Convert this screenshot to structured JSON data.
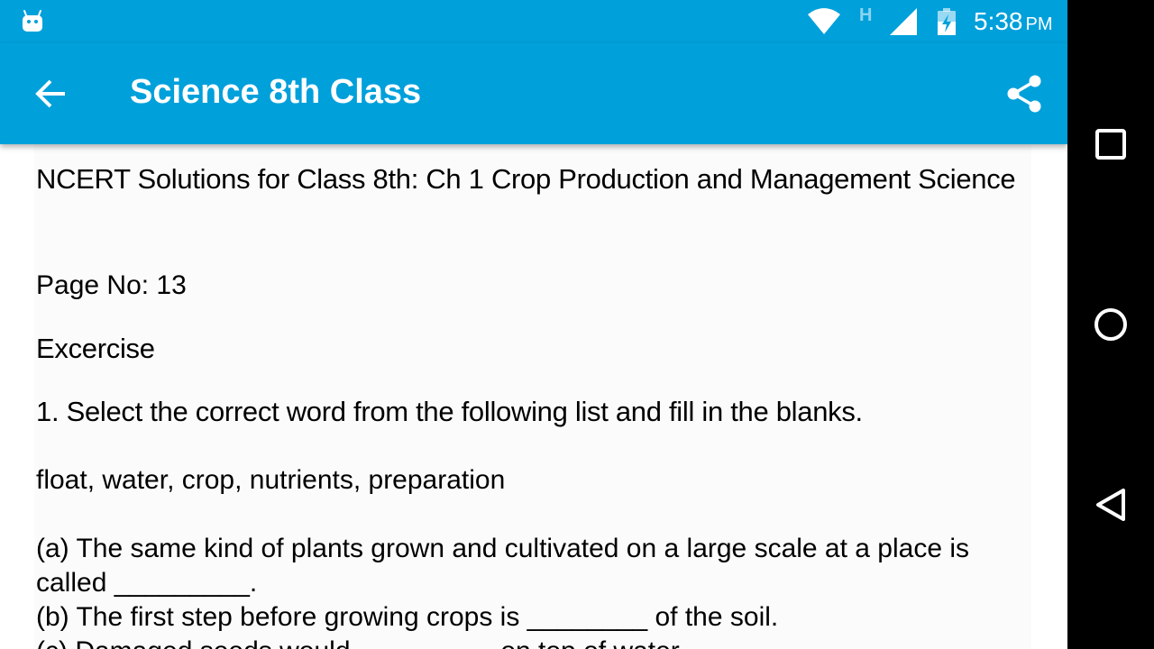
{
  "status_bar": {
    "network_type": "H",
    "time": "5:38",
    "ampm": "PM",
    "icons": [
      "android-icon",
      "wifi-icon",
      "signal-icon",
      "battery-icon"
    ]
  },
  "app_bar": {
    "title": "Science 8th Class",
    "back_icon": "arrow-back-icon",
    "share_icon": "share-icon",
    "background_color": "#00a0db"
  },
  "content": {
    "doc_title": "NCERT Solutions for Class 8th: Ch 1 Crop Production and Management Science",
    "page_no": "Page No: 13",
    "exercise_heading": "Excercise",
    "question_1": "1. Select the correct word from the following list and fill in the blanks.",
    "word_list": "float, water, crop, nutrients, preparation",
    "line_a": "(a) The same kind of plants grown and cultivated on a large scale at a place is called _________.",
    "line_b": "(b) The first step before growing crops is ________ of the soil.",
    "line_c": "(c) Damaged seeds would _________ on top of water."
  },
  "nav_bar": {
    "icons": [
      "recents-square-icon",
      "home-circle-icon",
      "back-triangle-icon"
    ]
  }
}
